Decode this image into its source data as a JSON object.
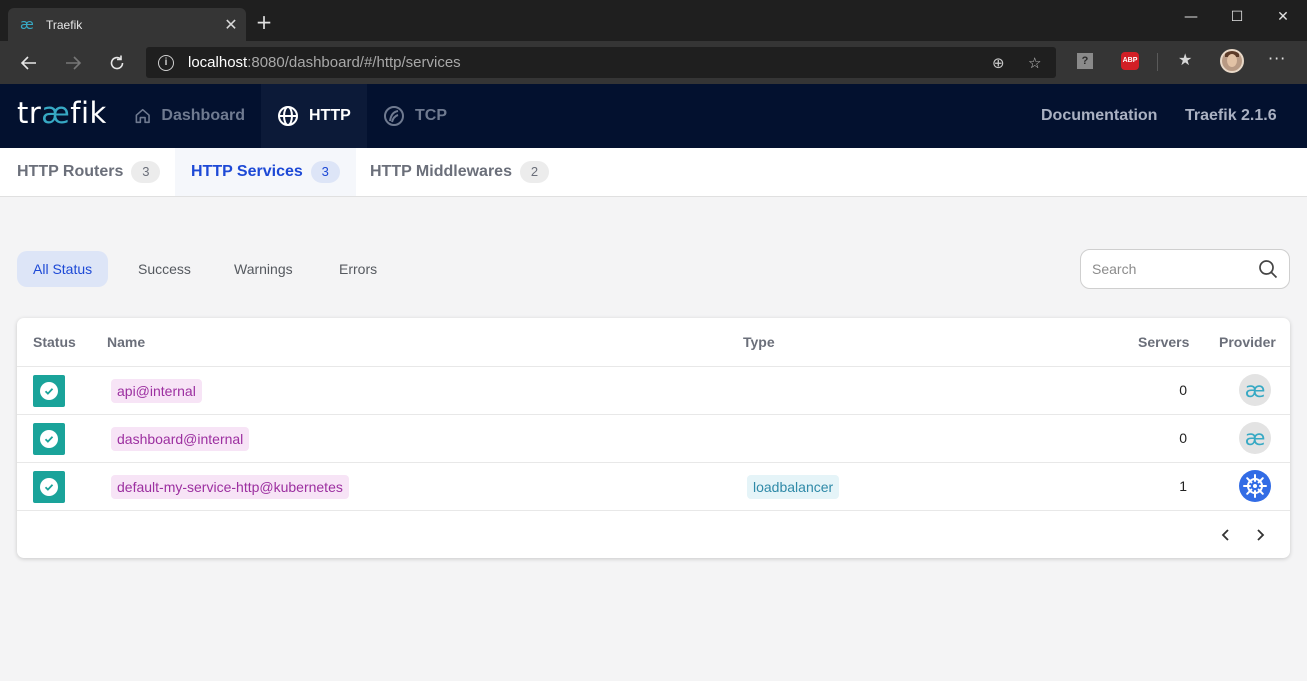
{
  "browser": {
    "tab_title": "Traefik",
    "tab_favicon": "æ",
    "address_host": "localhost",
    "address_path": ":8080/dashboard/#/http/services",
    "ext_help_label": "?",
    "ext_abp_label": "ABP"
  },
  "header": {
    "brand_prefix": "tr",
    "brand_ae": "æ",
    "brand_suffix": "fik",
    "nav": [
      {
        "label": "Dashboard",
        "icon": "home-icon"
      },
      {
        "label": "HTTP",
        "icon": "globe-icon"
      },
      {
        "label": "TCP",
        "icon": "tcp-icon"
      }
    ],
    "documentation": "Documentation",
    "version": "Traefik 2.1.6"
  },
  "subtabs": [
    {
      "label": "HTTP Routers",
      "count": "3"
    },
    {
      "label": "HTTP Services",
      "count": "3"
    },
    {
      "label": "HTTP Middlewares",
      "count": "2"
    }
  ],
  "filters": [
    "All Status",
    "Success",
    "Warnings",
    "Errors"
  ],
  "search": {
    "placeholder": "Search"
  },
  "table": {
    "headers": {
      "status": "Status",
      "name": "Name",
      "type": "Type",
      "servers": "Servers",
      "provider": "Provider"
    },
    "rows": [
      {
        "name": "api@internal",
        "type": "",
        "servers": "0",
        "provider": "internal",
        "provider_glyph": "æ"
      },
      {
        "name": "dashboard@internal",
        "type": "",
        "servers": "0",
        "provider": "internal",
        "provider_glyph": "æ"
      },
      {
        "name": "default-my-service-http@kubernetes",
        "type": "loadbalancer",
        "servers": "1",
        "provider": "kubernetes"
      }
    ]
  },
  "colors": {
    "header_bg": "#03112f",
    "accent_blue": "#1d49d6",
    "status_green": "#1aa39a",
    "traefik_teal": "#37a9c4",
    "k8s_blue": "#326ce5"
  }
}
